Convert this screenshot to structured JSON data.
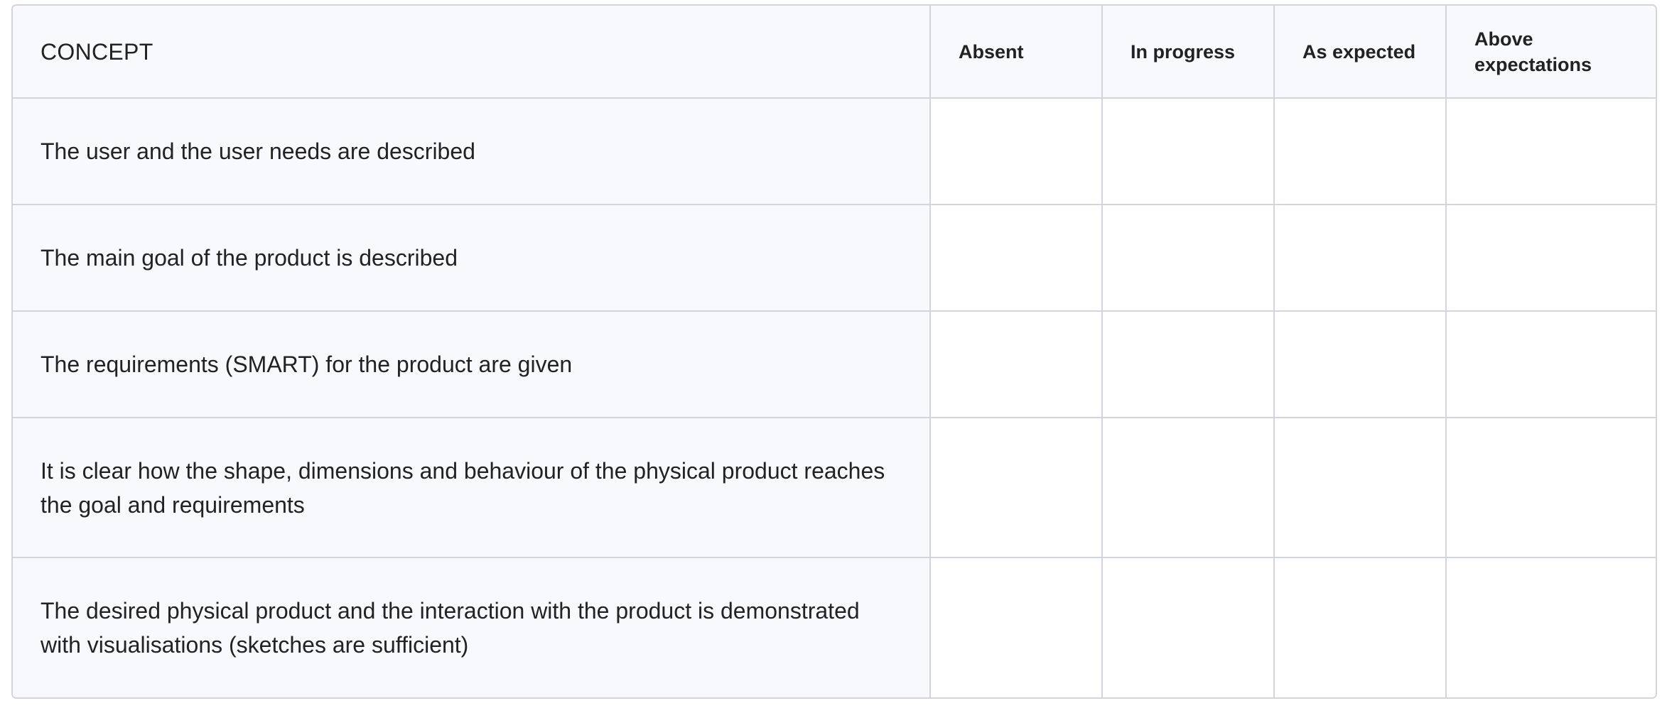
{
  "rubric": {
    "section_label": "CONCEPT",
    "columns": [
      "Absent",
      "In progress",
      "As expected",
      "Above expectations"
    ],
    "criteria": [
      "The user and the user needs are described",
      "The main goal of the product is described",
      "The requirements (SMART) for the product are given",
      "It is clear how the shape, dimensions and behaviour of the physical product reaches the goal and requirements",
      "The desired physical product and the interaction with the product is demonstrated with visualisations (sketches are sufficient)"
    ]
  },
  "colors": {
    "border": "#d2d6dc",
    "header_background": "#f8f9fd",
    "cell_background": "#ffffff",
    "text": "#222222"
  }
}
